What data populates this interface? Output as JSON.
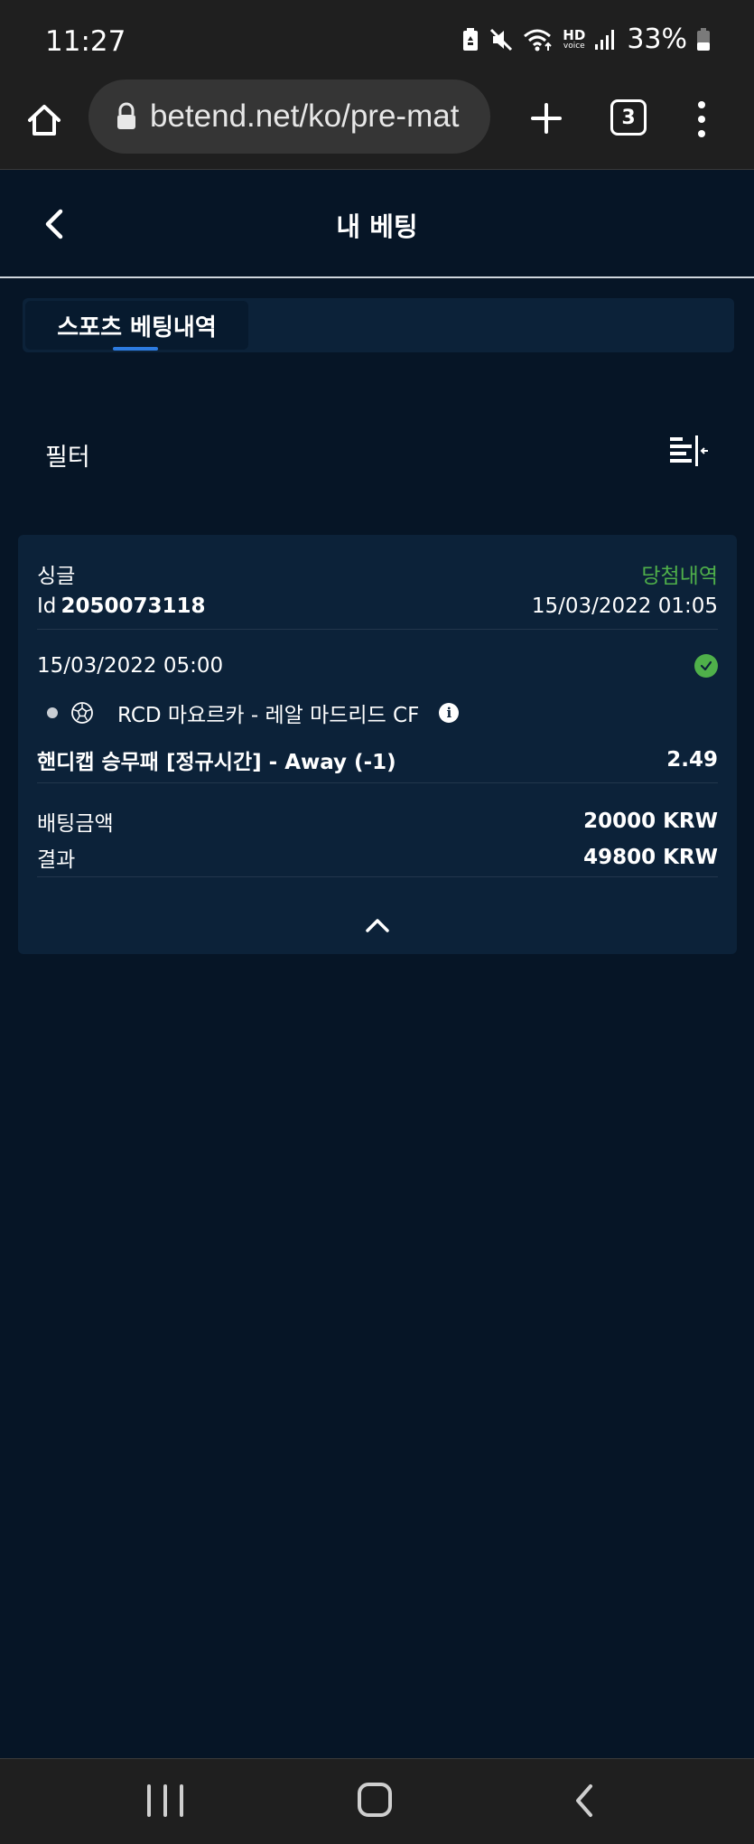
{
  "status_bar": {
    "time": "11:27",
    "battery_percent": "33%",
    "hd_label": "HD",
    "voice_label": "voice"
  },
  "browser": {
    "url": "betend.net/ko/pre-mat",
    "tab_count": "3"
  },
  "header": {
    "title": "내 베팅"
  },
  "tabs": [
    {
      "label": "스포츠 베팅내역",
      "active": true
    }
  ],
  "filter": {
    "label": "필터"
  },
  "bet": {
    "type": "싱글",
    "status": "당첨내역",
    "id_label": "Id",
    "id_value": "2050073118",
    "placed_at": "15/03/2022 01:05",
    "event_time": "15/03/2022 05:00",
    "match": "RCD 마요르카 - 레알 마드리드 CF",
    "market": "핸디캡 승무패 [정규시간] - Away (-1)",
    "odds": "2.49",
    "stake_label": "배팅금액",
    "stake_value": "20000 KRW",
    "result_label": "결과",
    "result_value": "49800 KRW"
  },
  "colors": {
    "background": "#061526",
    "card": "#0c2239",
    "won_green": "#4fb04a",
    "tab_accent": "#2d7be0"
  },
  "icons": {
    "home": "home-icon",
    "lock": "lock-icon",
    "plus": "plus-icon",
    "menu": "more-vert-icon",
    "back": "chevron-left-icon",
    "filter": "filter-collapse-icon",
    "won": "check-circle-icon",
    "sport": "soccer-ball-icon",
    "info": "info-icon",
    "collapse": "chevron-up-icon"
  }
}
